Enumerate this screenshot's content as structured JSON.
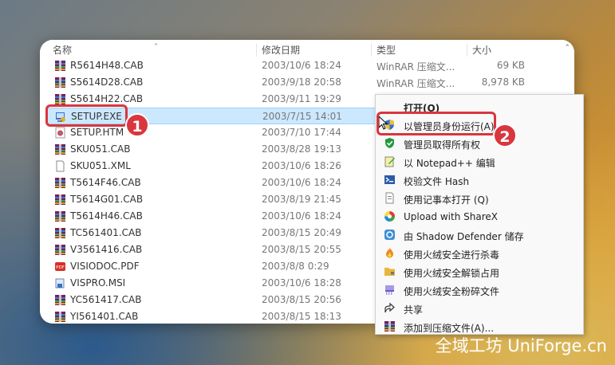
{
  "columns": {
    "name": "名称",
    "date": "修改日期",
    "type": "类型",
    "size": "大小"
  },
  "files": [
    {
      "name": "R5614H48.CAB",
      "date": "2003/10/6 18:24",
      "type": "WinRAR 压缩文...",
      "size": "69 KB",
      "icon": "winrar-icon"
    },
    {
      "name": "S5614D28.CAB",
      "date": "2003/9/18 20:58",
      "type": "WinRAR 压缩文...",
      "size": "8,978 KB",
      "icon": "winrar-icon"
    },
    {
      "name": "S5614H22.CAB",
      "date": "2003/9/11 19:29",
      "type": "",
      "size": "",
      "icon": "winrar-icon"
    },
    {
      "name": "SETUP.EXE",
      "date": "2003/7/15 14:01",
      "type": "",
      "size": "",
      "icon": "setup-exe-icon"
    },
    {
      "name": "SETUP.HTM",
      "date": "2003/7/10 17:44",
      "type": "",
      "size": "",
      "icon": "html-icon"
    },
    {
      "name": "SKU051.CAB",
      "date": "2003/8/28 19:13",
      "type": "",
      "size": "",
      "icon": "winrar-icon"
    },
    {
      "name": "SKU051.XML",
      "date": "2003/10/6 18:26",
      "type": "",
      "size": "",
      "icon": "document-icon"
    },
    {
      "name": "T5614F46.CAB",
      "date": "2003/10/6 18:24",
      "type": "",
      "size": "",
      "icon": "winrar-icon"
    },
    {
      "name": "T5614G01.CAB",
      "date": "2003/8/19 21:45",
      "type": "",
      "size": "",
      "icon": "winrar-icon"
    },
    {
      "name": "T5614H46.CAB",
      "date": "2003/10/6 18:24",
      "type": "",
      "size": "",
      "icon": "winrar-icon"
    },
    {
      "name": "TC561401.CAB",
      "date": "2003/8/15 20:49",
      "type": "",
      "size": "",
      "icon": "winrar-icon"
    },
    {
      "name": "V3561416.CAB",
      "date": "2003/8/15 20:55",
      "type": "",
      "size": "",
      "icon": "winrar-icon"
    },
    {
      "name": "VISIODOC.PDF",
      "date": "2003/8/8 0:29",
      "type": "",
      "size": "",
      "icon": "pdf-icon"
    },
    {
      "name": "VISPRO.MSI",
      "date": "2003/10/6 18:28",
      "type": "",
      "size": "",
      "icon": "msi-icon"
    },
    {
      "name": "YC561417.CAB",
      "date": "2003/8/15 20:56",
      "type": "",
      "size": "",
      "icon": "winrar-icon"
    },
    {
      "name": "YI561401.CAB",
      "date": "2003/8/15 18:13",
      "type": "",
      "size": "",
      "icon": "winrar-icon"
    }
  ],
  "context_menu": [
    {
      "label": "打开(O)",
      "icon": "",
      "bold": true
    },
    {
      "label": "以管理员身份运行(A)",
      "icon": "uac-shield-icon"
    },
    {
      "label": "管理员取得所有权",
      "icon": "green-shield-icon"
    },
    {
      "label": "以 Notepad++ 编辑",
      "icon": "notepadpp-icon"
    },
    {
      "label": "校验文件 Hash",
      "icon": "hash-icon"
    },
    {
      "label": "使用记事本打开 (Q)",
      "icon": "notepad-icon"
    },
    {
      "label": "Upload with ShareX",
      "icon": "sharex-icon"
    },
    {
      "label": "由 Shadow Defender 储存",
      "icon": "shadow-defender-icon"
    },
    {
      "label": "使用火绒安全进行杀毒",
      "icon": "huorong-icon"
    },
    {
      "label": "使用火绒安全解锁占用",
      "icon": "folder-unlock-icon"
    },
    {
      "label": "使用火绒安全粉碎文件",
      "icon": "shredder-icon"
    },
    {
      "label": "共享",
      "icon": "share-icon"
    },
    {
      "label": "添加到压缩文件(A)...",
      "icon": "winrar-icon"
    }
  ],
  "callouts": {
    "one": "1",
    "two": "2"
  },
  "watermark": "全域工坊 UniForge.cn",
  "colors": {
    "accent_red": "#d9363e",
    "selection": "#cce8ff"
  }
}
